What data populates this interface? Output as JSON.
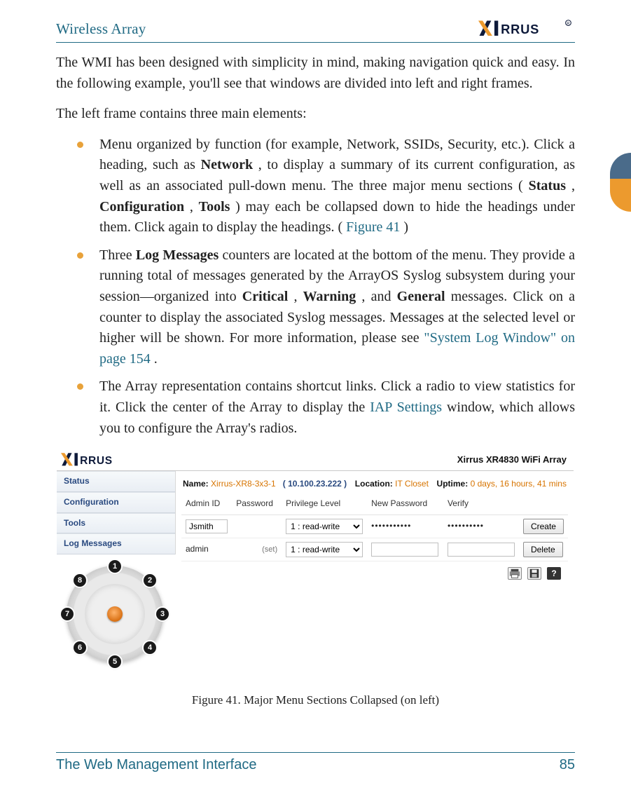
{
  "header": {
    "title": "Wireless Array",
    "brand": "XIRRUS"
  },
  "body": {
    "p1_a": "The WMI has been designed with simplicity in mind, making navigation quick and easy. In the following example, you'll see that windows are divided into left and right frames.",
    "p2": "The left frame contains three main elements:",
    "b1_a": "Menu organized by function (for example, Network, SSIDs, Security, etc.). Click a heading, such as ",
    "b1_bold1": "Network",
    "b1_b": ", to display a summary of its current configuration, as well as an associated pull-down menu. The three major menu sections (",
    "b1_bold2": "Status",
    "b1_c": ", ",
    "b1_bold3": "Configuration",
    "b1_d": ", ",
    "b1_bold4": "Tools",
    "b1_e": ") may each be collapsed down to hide the headings under them. Click again to display the headings. (",
    "b1_link": "Figure 41",
    "b1_f": " )",
    "b2_a": "Three ",
    "b2_bold1": "Log Messages",
    "b2_b": " counters are located at the bottom of the menu. They provide a running total of messages generated by the ArrayOS Syslog subsystem during your session—organized into ",
    "b2_bold2": "Critical",
    "b2_c": ", ",
    "b2_bold3": "Warning",
    "b2_d": ", and ",
    "b2_bold4": "General",
    "b2_e": " messages. Click on a counter to display the associated Syslog messages. Messages at the selected level or higher will be shown. For more information, please see ",
    "b2_link": "\"System Log Window\" on page 154",
    "b2_f": ".",
    "b3_a": "The Array representation contains shortcut links. Click a radio to view statistics for it. Click the center of the Array to display the ",
    "b3_link": "IAP Settings",
    "b3_b": " window, which allows you to configure the Array's radios."
  },
  "figure": {
    "topbrand": "XIRRUS",
    "title_right": "Xirrus XR4830 WiFi Array",
    "menu": {
      "items": [
        "Status",
        "Configuration",
        "Tools",
        "Log Messages"
      ]
    },
    "radios": [
      "1",
      "2",
      "3",
      "4",
      "5",
      "6",
      "7",
      "8"
    ],
    "info": {
      "name_k": "Name:",
      "name_v": "Xirrus-XR8-3x3-1",
      "ip": "( 10.100.23.222 )",
      "loc_k": "Location:",
      "loc_v": "IT Closet",
      "up_k": "Uptime:",
      "up_v": "0 days, 16 hours, 41 mins"
    },
    "cols": {
      "c1": "Admin ID",
      "c2": "Password",
      "c3": "Privilege Level",
      "c4": "New Password",
      "c5": "Verify"
    },
    "row1": {
      "admin": "Jsmith",
      "pwd": "",
      "priv": "1 : read-write",
      "newpwd": "•••••••••••",
      "verify": "••••••••••",
      "btn": "Create"
    },
    "row2": {
      "admin": "admin",
      "set": "(set)",
      "priv": "1 : read-write",
      "newpwd": "",
      "verify": "",
      "btn": "Delete"
    },
    "help": "?"
  },
  "caption": "Figure 41. Major Menu Sections Collapsed (on left)",
  "footer": {
    "left": "The Web Management Interface",
    "right": "85"
  }
}
